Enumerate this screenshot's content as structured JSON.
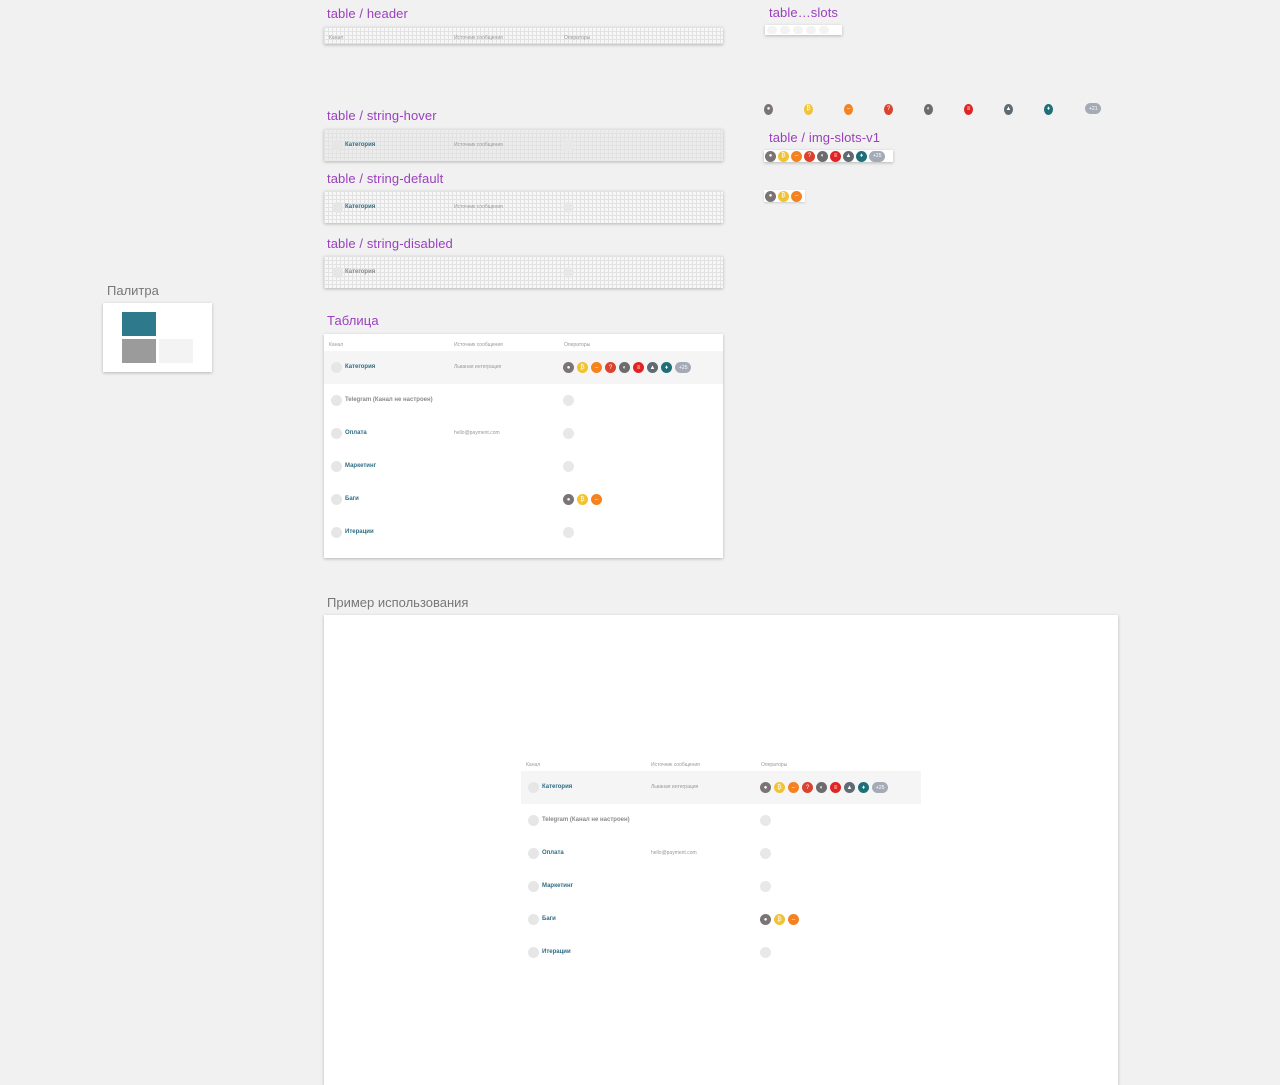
{
  "frames": {
    "header_title": "table / header",
    "hover_title": "table / string-hover",
    "default_title": "table / string-default",
    "disabled_title": "table / string-disabled",
    "slots_title": "table…slots",
    "img_slots_title": "table / img-slots-v1",
    "table_title": "Таблица",
    "palette_title": "Палитра",
    "usage_title": "Пример использования"
  },
  "columns": {
    "channel": "Канал",
    "source": "Источник сообщения",
    "operators": "Операторы"
  },
  "sample_row": {
    "category": "Категория",
    "source": "Источник сообщения"
  },
  "colors": {
    "accent": "#9b3fbf",
    "category_text": "#2f6e86",
    "palette": [
      "#2e7a8c",
      "#9b9b9b",
      "#f3f3f3"
    ]
  },
  "avatars": [
    {
      "icon": "raccoon-avatar-icon",
      "bg": "#7a7474",
      "glyph": "●"
    },
    {
      "icon": "bitcoin-avatar-icon",
      "bg": "#f1c232",
      "glyph": "₿"
    },
    {
      "icon": "orange-avatar-icon",
      "bg": "#f5821f",
      "glyph": "–"
    },
    {
      "icon": "red-avatar-icon",
      "bg": "#d9432f",
      "glyph": "?"
    },
    {
      "icon": "bw-avatar-icon",
      "bg": "#6c6c6c",
      "glyph": "◐"
    },
    {
      "icon": "stripes-avatar-icon",
      "bg": "#e02424",
      "glyph": "≡"
    },
    {
      "icon": "car-avatar-icon",
      "bg": "#5f6b73",
      "glyph": "▲"
    },
    {
      "icon": "teal-avatar-icon",
      "bg": "#1f6f78",
      "glyph": "♦"
    }
  ],
  "slots_more": "+21",
  "more_count": "+25",
  "table": {
    "rows": [
      {
        "category": "Категория",
        "source": "Льваная интеграция",
        "operators": "all",
        "disabled": false,
        "hover": true
      },
      {
        "category": "Telegram (Канал не настроен)",
        "source": "",
        "operators": "none",
        "disabled": true,
        "hover": false
      },
      {
        "category": "Оплата",
        "source": "hello@payment.com",
        "operators": "none",
        "disabled": false,
        "hover": false
      },
      {
        "category": "Маркетинг",
        "source": "",
        "operators": "none",
        "disabled": false,
        "hover": false
      },
      {
        "category": "Баги",
        "source": "",
        "operators": "three",
        "disabled": false,
        "hover": false
      },
      {
        "category": "Итерации",
        "source": "",
        "operators": "none",
        "disabled": false,
        "hover": false
      }
    ]
  }
}
